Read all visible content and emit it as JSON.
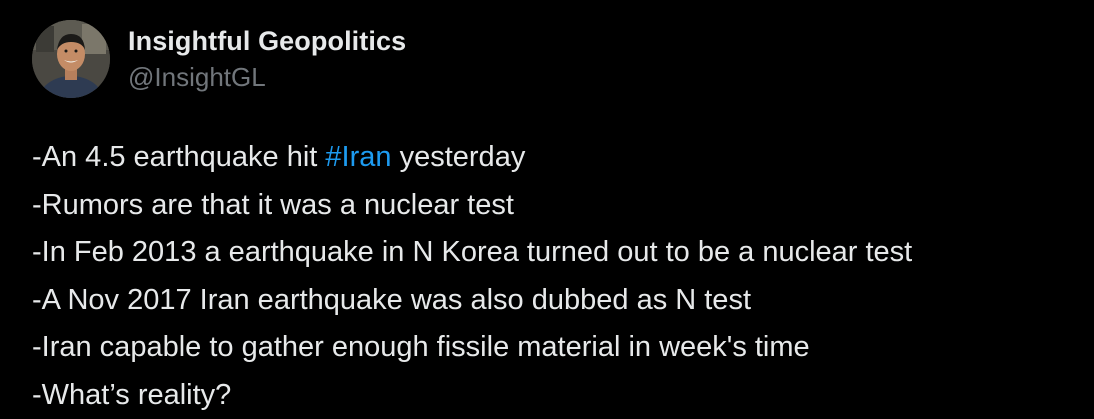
{
  "author": {
    "display_name": "Insightful Geopolitics",
    "handle": "@InsightGL"
  },
  "tweet": {
    "line1_prefix": "-An 4.5 earthquake hit ",
    "line1_hashtag": "#Iran",
    "line1_suffix": " yesterday",
    "line2": "-Rumors are that it was a nuclear test",
    "line3": "-In Feb 2013 a earthquake in N Korea turned out to be a nuclear test",
    "line4": "-A Nov 2017 Iran earthquake was also dubbed as N test",
    "line5": "-Iran capable to gather enough fissile material in week's time",
    "line6": "-What’s reality?"
  },
  "colors": {
    "background": "#000000",
    "text": "#e7e9ea",
    "secondary_text": "#71767b",
    "hashtag": "#1d9bf0"
  }
}
